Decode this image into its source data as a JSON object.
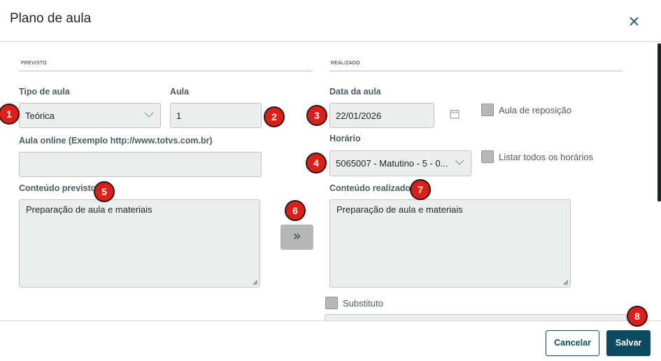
{
  "dialog": {
    "title": "Plano de aula",
    "close_icon": "close-icon"
  },
  "previsto": {
    "section_label": "PREVISTO",
    "tipo_label": "Tipo de aula",
    "tipo_value": "Teórica",
    "aula_label": "Aula",
    "aula_value": "1",
    "online_label": "Aula online (Exemplo http://www.totvs.com.br)",
    "online_value": "",
    "conteudo_label": "Conteúdo previsto",
    "conteudo_value": "Preparação de aula e materiais"
  },
  "copy_button": {
    "label": "»",
    "icon": "double-chevron-right-icon"
  },
  "realizado": {
    "section_label": "REALIZADO",
    "data_label": "Data da aula",
    "data_value": "22/01/2026",
    "reposicao_label": "Aula de reposição",
    "horario_label": "Horário",
    "horario_value": "5065007 - Matutino - 5 - 0...",
    "listar_label": "Listar todos os horários",
    "conteudo_label": "Conteúdo realizado",
    "conteudo_value": "Preparação de aula e materiais",
    "substituto_label": "Substituto"
  },
  "footer": {
    "cancel_label": "Cancelar",
    "save_label": "Salvar"
  },
  "annotations": [
    "1",
    "2",
    "3",
    "4",
    "5",
    "6",
    "7",
    "8"
  ],
  "colors": {
    "primary": "#0c4a62",
    "badge": "#e11d17",
    "field_bg": "#eceeee",
    "checkbox": "#b6b8b8"
  }
}
